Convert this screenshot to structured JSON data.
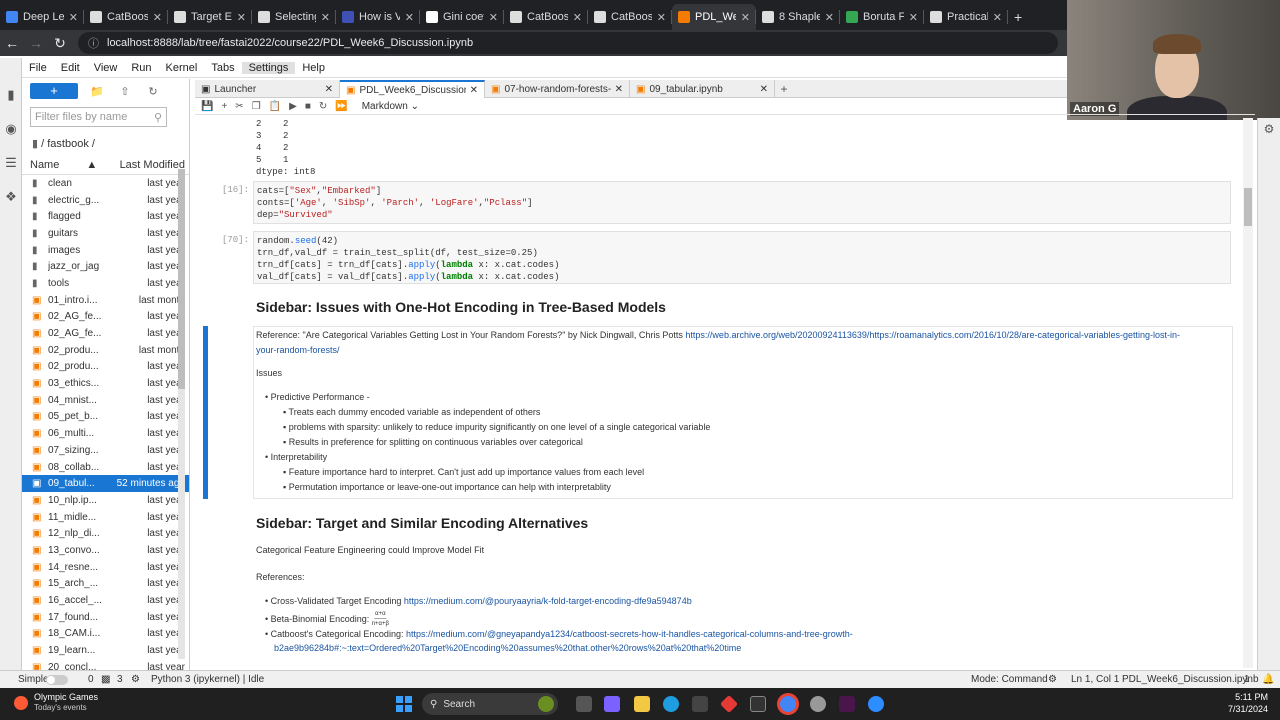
{
  "browser": {
    "tabs": [
      {
        "label": "Deep Lea",
        "color": "#4285f4"
      },
      {
        "label": "CatBoost",
        "color": "#dddddd"
      },
      {
        "label": "Target Enc",
        "color": "#dddddd"
      },
      {
        "label": "Selecting",
        "color": "#dddddd"
      },
      {
        "label": "How is Va",
        "color": "#3f51b5"
      },
      {
        "label": "Gini coeffic",
        "color": "#ffffff"
      },
      {
        "label": "CatBoost",
        "color": "#dddddd"
      },
      {
        "label": "CatBoost",
        "color": "#dddddd"
      },
      {
        "label": "PDL_Week",
        "color": "#f57c00"
      },
      {
        "label": "8 Shapley",
        "color": "#dddddd"
      },
      {
        "label": "Boruta Fe",
        "color": "#34a853"
      },
      {
        "label": "Practical D",
        "color": "#dddddd"
      }
    ],
    "url": "localhost:8888/lab/tree/fastai2022/course22/PDL_Week6_Discussion.ipynb"
  },
  "menu": [
    "File",
    "Edit",
    "View",
    "Run",
    "Kernel",
    "Tabs",
    "Settings",
    "Help"
  ],
  "filebrowser": {
    "new_label": "+",
    "filter_placeholder": "Filter files by name",
    "breadcrumb": "/ fastbook /",
    "col_name": "Name",
    "col_modified": "Last Modified",
    "files": [
      {
        "name": "clean",
        "mod": "last year",
        "type": "folder"
      },
      {
        "name": "electric_g...",
        "mod": "last year",
        "type": "folder"
      },
      {
        "name": "flagged",
        "mod": "last year",
        "type": "folder"
      },
      {
        "name": "guitars",
        "mod": "last year",
        "type": "folder"
      },
      {
        "name": "images",
        "mod": "last year",
        "type": "folder"
      },
      {
        "name": "jazz_or_jag",
        "mod": "last year",
        "type": "folder"
      },
      {
        "name": "tools",
        "mod": "last year",
        "type": "folder"
      },
      {
        "name": "01_intro.i...",
        "mod": "last month",
        "type": "nb"
      },
      {
        "name": "02_AG_fe...",
        "mod": "last year",
        "type": "nb"
      },
      {
        "name": "02_AG_fe...",
        "mod": "last year",
        "type": "nb"
      },
      {
        "name": "02_produ...",
        "mod": "last month",
        "type": "nb"
      },
      {
        "name": "02_produ...",
        "mod": "last year",
        "type": "nb"
      },
      {
        "name": "03_ethics...",
        "mod": "last year",
        "type": "nb"
      },
      {
        "name": "04_mnist...",
        "mod": "last year",
        "type": "nb"
      },
      {
        "name": "05_pet_b...",
        "mod": "last year",
        "type": "nb"
      },
      {
        "name": "06_multi...",
        "mod": "last year",
        "type": "nb"
      },
      {
        "name": "07_sizing...",
        "mod": "last year",
        "type": "nb"
      },
      {
        "name": "08_collab...",
        "mod": "last year",
        "type": "nb"
      },
      {
        "name": "09_tabul...",
        "mod": "52 minutes ago",
        "type": "nb",
        "selected": true
      },
      {
        "name": "10_nlp.ip...",
        "mod": "last year",
        "type": "nb"
      },
      {
        "name": "11_midle...",
        "mod": "last year",
        "type": "nb"
      },
      {
        "name": "12_nlp_di...",
        "mod": "last year",
        "type": "nb"
      },
      {
        "name": "13_convo...",
        "mod": "last year",
        "type": "nb"
      },
      {
        "name": "14_resne...",
        "mod": "last year",
        "type": "nb"
      },
      {
        "name": "15_arch_...",
        "mod": "last year",
        "type": "nb"
      },
      {
        "name": "16_accel_...",
        "mod": "last year",
        "type": "nb"
      },
      {
        "name": "17_found...",
        "mod": "last year",
        "type": "nb"
      },
      {
        "name": "18_CAM.i...",
        "mod": "last year",
        "type": "nb"
      },
      {
        "name": "19_learn...",
        "mod": "last year",
        "type": "nb"
      },
      {
        "name": "20_concl...",
        "mod": "last year",
        "type": "nb"
      }
    ]
  },
  "nbtabs": [
    {
      "label": "Launcher"
    },
    {
      "label": "PDL_Week6_Discussion.ipynb",
      "active": true
    },
    {
      "label": "07-how-random-forests-real"
    },
    {
      "label": "09_tabular.ipynb"
    }
  ],
  "celltype": "Markdown",
  "notebook": {
    "output_lines": [
      "2    2",
      "3    2",
      "4    2",
      "5    1",
      "dtype: int8"
    ],
    "cell16": {
      "prompt": "[16]:"
    },
    "cell70": {
      "prompt": "[70]:"
    },
    "h_onehot": "Sidebar: Issues with One-Hot Encoding in Tree-Based Models",
    "ref_prefix": "Reference: \"Are Categorical Variables Getting Lost in Your Random Forests?\" by Nick Dingwall, Chris Potts ",
    "ref_link1": "https://web.archive.org/web/20200924113639/https://roamanalytics.com/2016/10/28/are-categorical-variables-getting-lost-in-",
    "ref_link2": "your-random-forests/",
    "issues": "Issues",
    "b1": "Predictive Performance -",
    "b1a": "Treats each dummy encoded variable as independent of others",
    "b1b": "problems with sparsity: unlikely to reduce impurity significantly on one level of a single categorical variable",
    "b1c": "Results in preference for splitting on continuous variables over categorical",
    "b2": "Interpretability",
    "b2a": "Feature importance hard to interpret. Can't just add up importance values from each level",
    "b2b": "Permutation importance or leave-one-out importance can help with interpretablity",
    "h_target": "Sidebar: Target and Similar Encoding Alternatives",
    "cat_fe": "Categorical Feature Engineering could Improve Model Fit",
    "refs": "References:",
    "r1": "Cross-Validated Target Encoding ",
    "r1l": "https://medium.com/@pouryaayria/k-fold-target-encoding-dfe9a594874b",
    "r2": "Beta-Binomial Encoding: ",
    "r3": "Catboost's Categorical Encoding: ",
    "r3l": "https://medium.com/@gneyapandya1234/catboost-secrets-how-it-handles-categorical-columns-and-tree-growth-",
    "r3l2": "b2ae9b96284b#:~:text=Ordered%20Target%20Encoding%20assumes%20that.other%20rows%20at%20that%20time"
  },
  "video": {
    "name": "Aaron G"
  },
  "status": {
    "mode_label": "Simple",
    "n0": "0",
    "n3": "3",
    "kernel": "Python 3 (ipykernel) | Idle",
    "mode": "Mode: Command",
    "position": "Ln 1, Col 1",
    "file": "PDL_Week6_Discussion.ipynb",
    "count": "1"
  },
  "taskbar": {
    "weather_title": "Olympic Games",
    "weather_sub": "Today's events",
    "search": "Search",
    "time": "5:11 PM",
    "date": "7/31/2024"
  }
}
